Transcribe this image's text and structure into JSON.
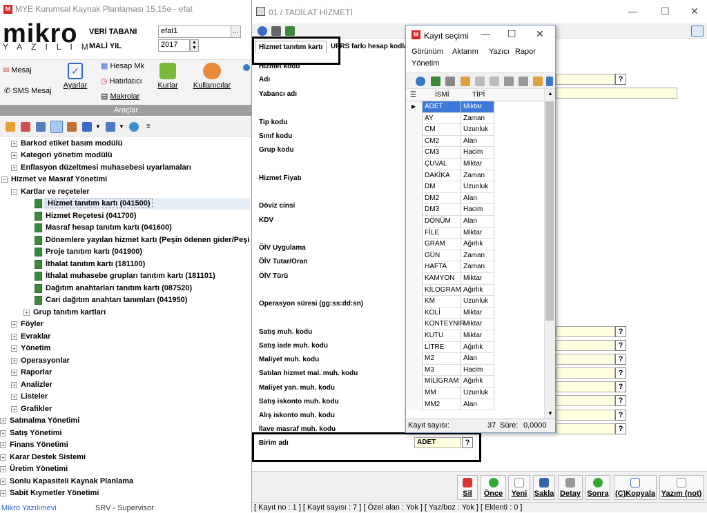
{
  "main_window": {
    "title": "MYE Kurumsal Kaynak Planlaması 15.15e - efat",
    "app_icon": "M",
    "logo_text": "mikro",
    "logo_sub": "YAZILIM",
    "db_label": "VERİ TABANI",
    "db_value": "efat1",
    "year_label": "MALİ YIL",
    "year_value": "2017",
    "ribbon": {
      "mesaj": "Mesaj",
      "sms": "SMS Mesaj",
      "ayarlar": "Ayarlar",
      "hesap_mk": "Hesap Mk",
      "hatirlatici": "Hatırlatıcı",
      "makrolar": "Makrolar",
      "kurlar": "Kurlar",
      "kullanicilar": "Kullanıcılar",
      "caption": "Araçlar"
    },
    "tree": [
      {
        "label": "Barkod etiket basım modülü",
        "kind": "plus"
      },
      {
        "label": "Kategori yönetim modülü",
        "kind": "plus"
      },
      {
        "label": "Enflasyon düzeltmesi muhasebesi uyarlamaları",
        "kind": "plus"
      },
      {
        "label": "Hizmet ve Masraf Yönetimi",
        "kind": "minus"
      },
      {
        "label": "Kartlar ve reçeteler",
        "kind": "minus"
      },
      {
        "label": "Hizmet tanıtım kartı (041500)",
        "kind": "doc"
      },
      {
        "label": "Hizmet Reçetesi (041700)",
        "kind": "doc"
      },
      {
        "label": "Masraf hesap tanıtım kartı (041600)",
        "kind": "doc"
      },
      {
        "label": "Dönemlere yayılan hizmet kartı (Peşin ödenen gider/Peşin tah",
        "kind": "doc"
      },
      {
        "label": "Proje tanıtım kartı (041900)",
        "kind": "doc"
      },
      {
        "label": "İthalat tanıtım kartı (181100)",
        "kind": "doc"
      },
      {
        "label": "İthalat muhasebe grupları tanıtım kartı (181101)",
        "kind": "doc"
      },
      {
        "label": "Dağıtım anahtarları tanıtım kartı (087520)",
        "kind": "doc"
      },
      {
        "label": "Cari dağıtım anahtarı tanımları (041950)",
        "kind": "doc"
      },
      {
        "label": "Grup tanıtım kartları",
        "kind": "plus"
      },
      {
        "label": "Föyler",
        "kind": "plus"
      },
      {
        "label": "Evraklar",
        "kind": "plus"
      },
      {
        "label": "Yönetim",
        "kind": "plus"
      },
      {
        "label": "Operasyonlar",
        "kind": "plus"
      },
      {
        "label": "Raporlar",
        "kind": "plus"
      },
      {
        "label": "Analizler",
        "kind": "plus"
      },
      {
        "label": "Listeler",
        "kind": "plus"
      },
      {
        "label": "Grafikler",
        "kind": "plus"
      },
      {
        "label": "Satınalma Yönetimi",
        "kind": "plus"
      },
      {
        "label": "Satış Yönetimi",
        "kind": "plus"
      },
      {
        "label": "Finans Yönetimi",
        "kind": "plus"
      },
      {
        "label": "Karar Destek Sistemi",
        "kind": "plus"
      },
      {
        "label": "Üretim Yönetimi",
        "kind": "plus"
      },
      {
        "label": "Sonlu Kapasiteli Kaynak Planlama",
        "kind": "plus"
      },
      {
        "label": "Sabit Kıymetler Yönetimi",
        "kind": "plus"
      }
    ],
    "status_left": "Mikro Yazılımevi",
    "status_user": "SRV - Supervisor"
  },
  "form_window": {
    "title": "01 / TADİLAT HİZMETİ",
    "tab1": "Hizmet tanıtım kartı",
    "tab2": "UFRS farkı hesap kodları",
    "fields": {
      "hizmet_kodu": "Hizmet kodu",
      "adi": "Adı",
      "yabanci_adi": "Yabancı adı",
      "tip_kodu": "Tip kodu",
      "sinif_kodu": "Sınıf kodu",
      "grup_kodu": "Grup kodu",
      "hizmet_fiyati": "Hizmet Fiyatı",
      "doviz_cinsi": "Döviz cinsi",
      "kdv": "KDV",
      "oiv_uygulama": "ÖİV Uygulama",
      "oiv_tutar": "ÖİV Tutar/Oran",
      "oiv_turu": "ÖİV Türü",
      "operasyon_suresi": "Operasyon süresi (gg:ss:dd:sn)",
      "satis_muh": "Satış muh. kodu",
      "satis_iade": "Satış iade muh. kodu",
      "maliyet_muh": "Maliyet muh. kodu",
      "satilan_hizmet": "Satılan hizmet mal. muh. kodu",
      "maliyet_yan": "Maliyet yan. muh. kodu",
      "satis_iskonto": "Satış iskonto muh. kodu",
      "alis_iskonto": "Alış iskonto muh. kodu",
      "ilave_masraf": "İlave masraf muh. kodu",
      "birim_adi": "Birim adı",
      "birim_value": "ADET"
    },
    "qmark": "?",
    "buttons": {
      "sil": "Sil",
      "once": "Önce",
      "yeni": "Yeni",
      "sakla": "Sakla",
      "detay": "Detay",
      "sonra": "Sonra",
      "kopyala": "(C)Kopyala",
      "yazim": "Yazım (not)"
    },
    "status": "[ Kayıt no : 1 ] [ Kayıt sayısı : 7 ] [ Özel alan : Yok ] [ Yaz/boz : Yok ] [ Eklenti : 0 ]"
  },
  "dialog": {
    "title": "Kayıt seçimi",
    "menu": [
      "Görünüm",
      "Aktarım",
      "Yazıcı",
      "Rapor",
      "Yönetim"
    ],
    "col_name": "İSMİ",
    "col_type": "TİPİ",
    "rows": [
      [
        "ADET",
        "Miktar"
      ],
      [
        "AY",
        "Zaman"
      ],
      [
        "CM",
        "Uzunluk"
      ],
      [
        "CM2",
        "Alan"
      ],
      [
        "CM3",
        "Hacim"
      ],
      [
        "ÇUVAL",
        "Miktar"
      ],
      [
        "DAKİKA",
        "Zaman"
      ],
      [
        "DM",
        "Uzunluk"
      ],
      [
        "DM2",
        "Alan"
      ],
      [
        "DM3",
        "Hacim"
      ],
      [
        "DÖNÜM",
        "Alan"
      ],
      [
        "FİLE",
        "Miktar"
      ],
      [
        "GRAM",
        "Ağırlık"
      ],
      [
        "GÜN",
        "Zaman"
      ],
      [
        "HAFTA",
        "Zaman"
      ],
      [
        "KAMYON",
        "Miktar"
      ],
      [
        "KİLOGRAM",
        "Ağırlık"
      ],
      [
        "KM",
        "Uzunluk"
      ],
      [
        "KOLİ",
        "Miktar"
      ],
      [
        "KONTEYNIR",
        "Miktar"
      ],
      [
        "KUTU",
        "Miktar"
      ],
      [
        "LİTRE",
        "Ağırlık"
      ],
      [
        "M2",
        "Alan"
      ],
      [
        "M3",
        "Hacim"
      ],
      [
        "MİLİGRAM",
        "Ağırlık"
      ],
      [
        "MM",
        "Uzunluk"
      ],
      [
        "MM2",
        "Alan"
      ]
    ],
    "count_label": "Kayıt sayısı:",
    "count_value": "37",
    "time_label": "Süre:",
    "time_value": "0,0000"
  }
}
